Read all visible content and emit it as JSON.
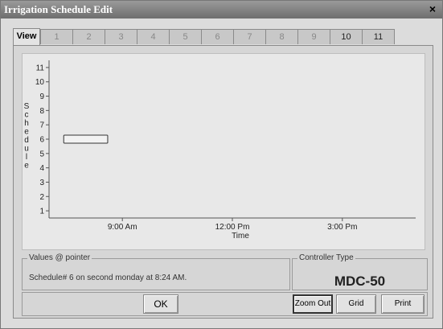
{
  "window": {
    "title": "Irrigation Schedule Edit",
    "close_label": "×"
  },
  "tabs": [
    {
      "label": "View",
      "state": "active"
    },
    {
      "label": "1",
      "state": "disabled"
    },
    {
      "label": "2",
      "state": "disabled"
    },
    {
      "label": "3",
      "state": "disabled"
    },
    {
      "label": "4",
      "state": "disabled"
    },
    {
      "label": "5",
      "state": "disabled"
    },
    {
      "label": "6",
      "state": "disabled"
    },
    {
      "label": "7",
      "state": "disabled"
    },
    {
      "label": "8",
      "state": "disabled"
    },
    {
      "label": "9",
      "state": "disabled"
    },
    {
      "label": "10",
      "state": "enabled"
    },
    {
      "label": "11",
      "state": "enabled"
    }
  ],
  "chart_data": {
    "type": "bar",
    "ylabel": "Schedule",
    "xlabel": "Time",
    "y_ticks": [
      "1",
      "2",
      "3",
      "4",
      "5",
      "6",
      "7",
      "8",
      "9",
      "10",
      "11"
    ],
    "ylim": [
      0.5,
      11.5
    ],
    "x_ticks": [
      {
        "label": "9:00 Am",
        "minutes": 540
      },
      {
        "label": "12:00 Pm",
        "minutes": 720
      },
      {
        "label": "3:00 Pm",
        "minutes": 900
      }
    ],
    "xlim_minutes": [
      420,
      1020
    ],
    "series": [
      {
        "schedule": 6,
        "start_minutes": 444,
        "end_minutes": 516
      }
    ]
  },
  "values_panel": {
    "legend": "Values @ pointer",
    "text": "Schedule# 6 on second monday at 8:24 AM."
  },
  "controller_panel": {
    "legend": "Controller Type",
    "model": "MDC-50"
  },
  "buttons": {
    "ok": "OK",
    "zoom_out": "Zoom Out",
    "grid": "Grid",
    "print": "Print"
  }
}
